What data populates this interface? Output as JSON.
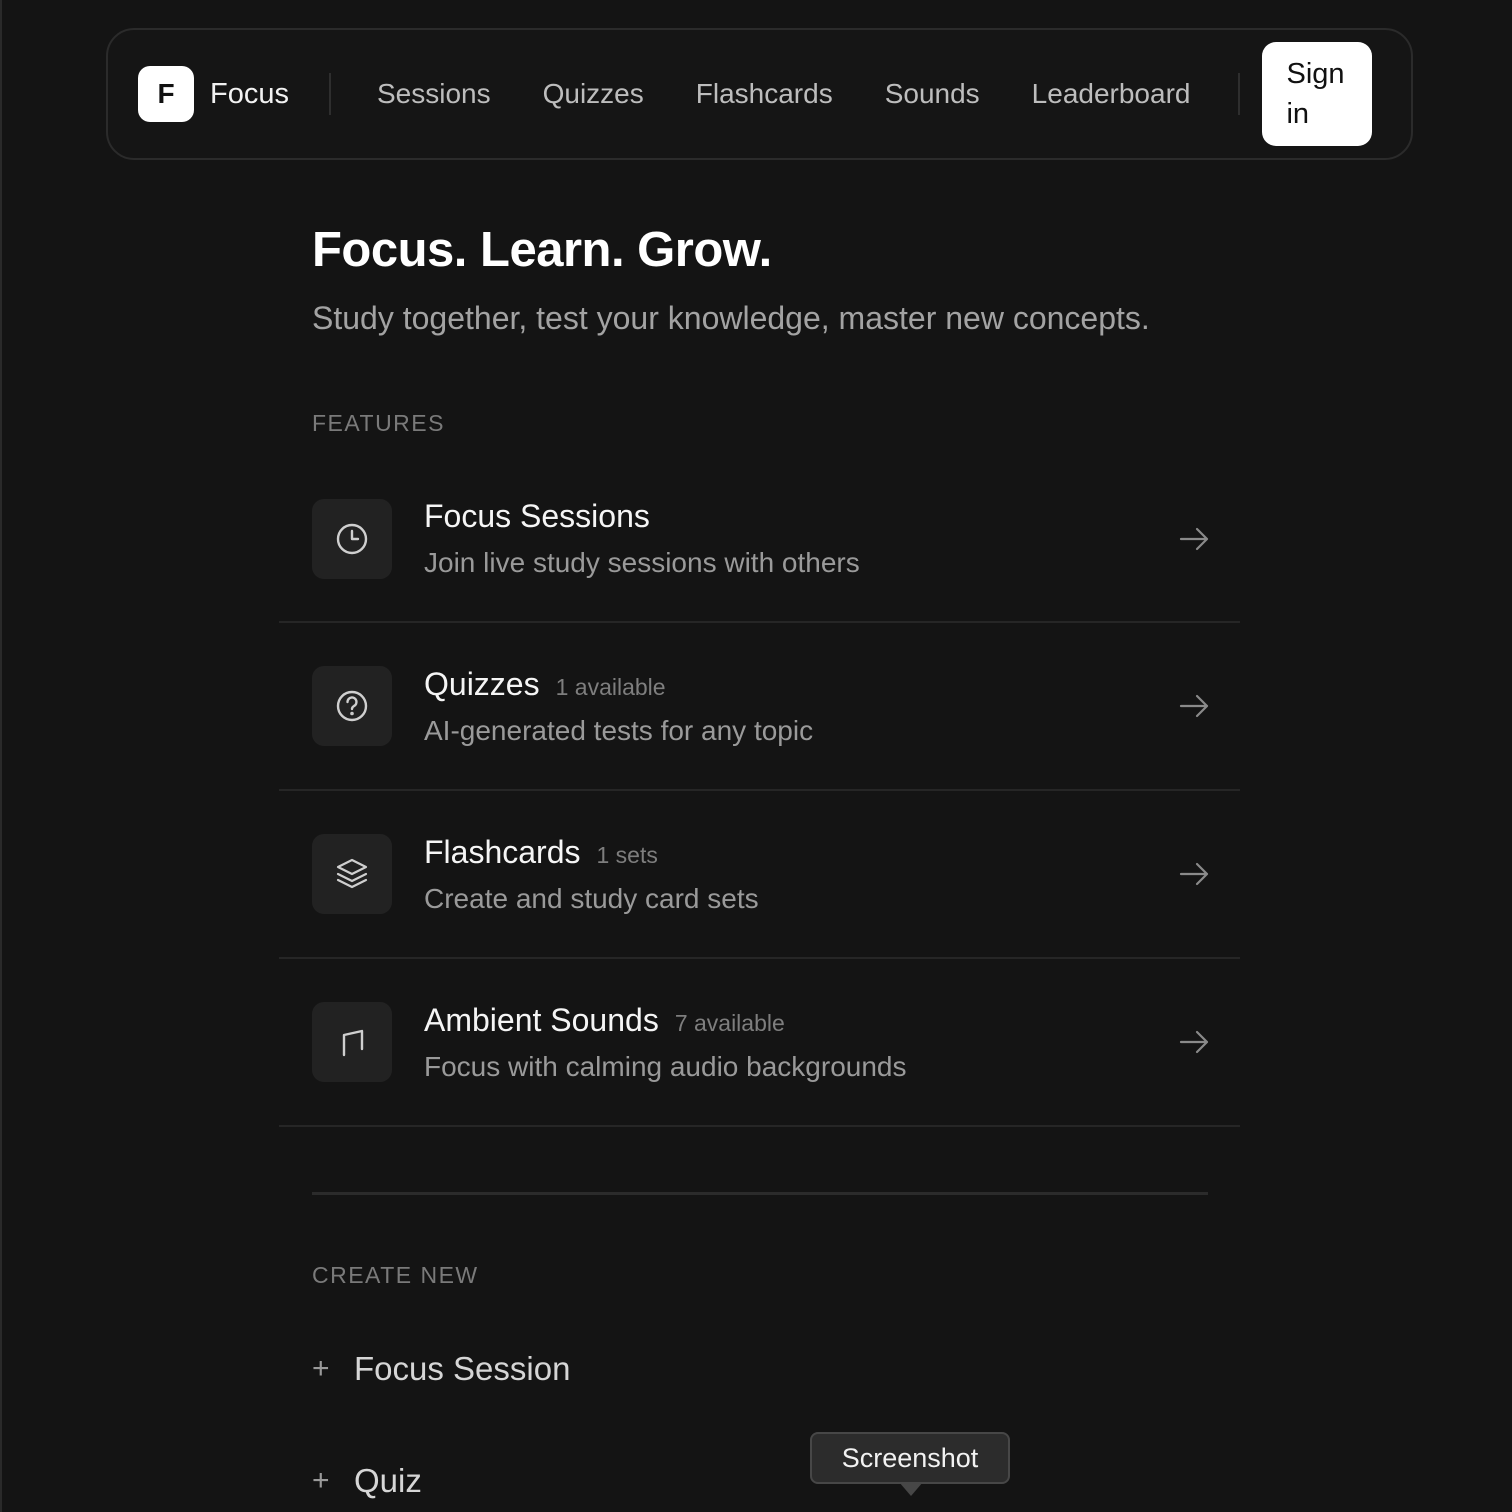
{
  "brand": {
    "mark": "F",
    "name": "Focus"
  },
  "nav": {
    "links": [
      "Sessions",
      "Quizzes",
      "Flashcards",
      "Sounds",
      "Leaderboard"
    ],
    "signin_label": "Sign in"
  },
  "hero": {
    "title": "Focus. Learn. Grow.",
    "subtitle": "Study together, test your knowledge, master new concepts."
  },
  "features_label": "FEATURES",
  "features": [
    {
      "title": "Focus Sessions",
      "badge": "",
      "description": "Join live study sessions with others",
      "icon": "clock-icon"
    },
    {
      "title": "Quizzes",
      "badge": "1 available",
      "description": "AI-generated tests for any topic",
      "icon": "question-circle-icon"
    },
    {
      "title": "Flashcards",
      "badge": "1 sets",
      "description": "Create and study card sets",
      "icon": "layers-icon"
    },
    {
      "title": "Ambient Sounds",
      "badge": "7 available",
      "description": "Focus with calming audio backgrounds",
      "icon": "music-note-icon"
    }
  ],
  "create_label": "CREATE NEW",
  "create_items": [
    {
      "plus": "+",
      "label": "Focus Session"
    },
    {
      "plus": "+",
      "label": "Quiz"
    }
  ],
  "tooltip": "Screenshot",
  "colors": {
    "background": "#141414",
    "accent": "#ffffff",
    "muted": "#9a9a9a"
  }
}
